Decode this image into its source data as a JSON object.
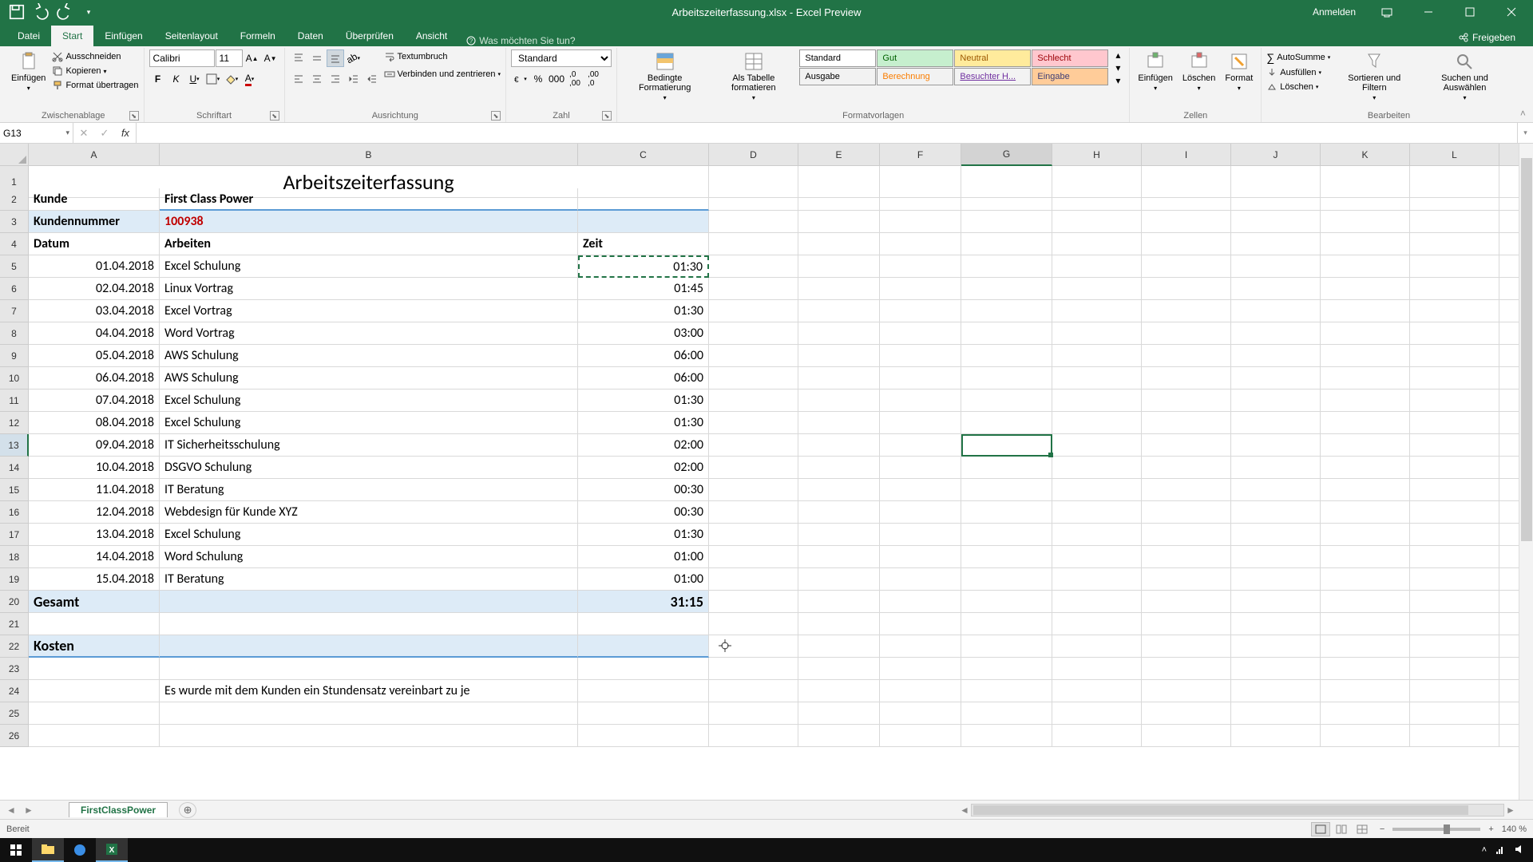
{
  "title": "Arbeitszeiterfassung.xlsx - Excel Preview",
  "signin": "Anmelden",
  "tabs": {
    "datei": "Datei",
    "start": "Start",
    "einfuegen": "Einfügen",
    "seitenlayout": "Seitenlayout",
    "formeln": "Formeln",
    "daten": "Daten",
    "ueberpruefen": "Überprüfen",
    "ansicht": "Ansicht",
    "tellme": "Was möchten Sie tun?",
    "share": "Freigeben"
  },
  "clipboard": {
    "paste": "Einfügen",
    "cut": "Ausschneiden",
    "copy": "Kopieren",
    "format": "Format übertragen",
    "label": "Zwischenablage"
  },
  "font": {
    "name": "Calibri",
    "size": "11",
    "label": "Schriftart"
  },
  "alignment": {
    "wrap": "Textumbruch",
    "merge": "Verbinden und zentrieren",
    "label": "Ausrichtung"
  },
  "number": {
    "format": "Standard",
    "label": "Zahl"
  },
  "styles": {
    "cond": "Bedingte Formatierung",
    "astable": "Als Tabelle formatieren",
    "standard": "Standard",
    "gut": "Gut",
    "neutral": "Neutral",
    "schlecht": "Schlecht",
    "ausgabe": "Ausgabe",
    "berechnung": "Berechnung",
    "besuchter": "Besuchter H...",
    "eingabe": "Eingabe",
    "label": "Formatvorlagen"
  },
  "cells": {
    "insert": "Einfügen",
    "delete": "Löschen",
    "format": "Format",
    "label": "Zellen"
  },
  "editing": {
    "autosum": "AutoSumme",
    "fill": "Ausfüllen",
    "clear": "Löschen",
    "sort": "Sortieren und Filtern",
    "find": "Suchen und Auswählen",
    "label": "Bearbeiten"
  },
  "namebox": "G13",
  "sheet": {
    "colheaders": [
      "A",
      "B",
      "C",
      "D",
      "E",
      "F",
      "G",
      "H",
      "I",
      "J",
      "K",
      "L"
    ],
    "title": "Arbeitszeiterfassung",
    "kunde_label": "Kunde",
    "kunde_value": "First Class Power",
    "kundennr_label": "Kundennummer",
    "kundennr_value": "100938",
    "hdr_datum": "Datum",
    "hdr_arbeiten": "Arbeiten",
    "hdr_zeit": "Zeit",
    "rows": [
      {
        "d": "01.04.2018",
        "a": "Excel Schulung",
        "z": "01:30"
      },
      {
        "d": "02.04.2018",
        "a": "Linux Vortrag",
        "z": "01:45"
      },
      {
        "d": "03.04.2018",
        "a": "Excel Vortrag",
        "z": "01:30"
      },
      {
        "d": "04.04.2018",
        "a": "Word Vortrag",
        "z": "03:00"
      },
      {
        "d": "05.04.2018",
        "a": "AWS Schulung",
        "z": "06:00"
      },
      {
        "d": "06.04.2018",
        "a": "AWS Schulung",
        "z": "06:00"
      },
      {
        "d": "07.04.2018",
        "a": "Excel Schulung",
        "z": "01:30"
      },
      {
        "d": "08.04.2018",
        "a": "Excel Schulung",
        "z": "01:30"
      },
      {
        "d": "09.04.2018",
        "a": "IT Sicherheitsschulung",
        "z": "02:00"
      },
      {
        "d": "10.04.2018",
        "a": "DSGVO Schulung",
        "z": "02:00"
      },
      {
        "d": "11.04.2018",
        "a": "IT Beratung",
        "z": "00:30"
      },
      {
        "d": "12.04.2018",
        "a": "Webdesign für Kunde XYZ",
        "z": "00:30"
      },
      {
        "d": "13.04.2018",
        "a": "Excel Schulung",
        "z": "01:30"
      },
      {
        "d": "14.04.2018",
        "a": "Word Schulung",
        "z": "01:00"
      },
      {
        "d": "15.04.2018",
        "a": "IT Beratung",
        "z": "01:00"
      }
    ],
    "gesamt_label": "Gesamt",
    "gesamt_value": "31:15",
    "kosten_label": "Kosten",
    "note": "Es wurde mit dem Kunden ein Stundensatz vereinbart zu je"
  },
  "sheettab": "FirstClassPower",
  "status": "Bereit",
  "zoom": "140 %"
}
